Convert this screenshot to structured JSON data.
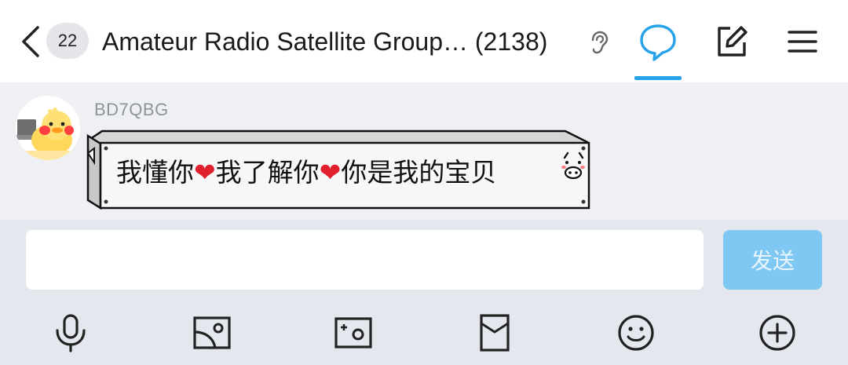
{
  "header": {
    "back_icon": "chevron-left-icon",
    "unread_count": "22",
    "title": "Amateur Radio Satellite Group… (2138)",
    "ear_icon": "ear-icon",
    "tabs": [
      {
        "name": "chat",
        "icon": "chat-bubble-icon",
        "active": true
      },
      {
        "name": "edit",
        "icon": "edit-icon"
      },
      {
        "name": "menu",
        "icon": "hamburger-menu-icon"
      }
    ],
    "accent_color": "#26a3e8"
  },
  "messages": [
    {
      "sender": "BD7QBG",
      "avatar": "duck-avatar",
      "text_parts": [
        "我懂你",
        "❤",
        "我了解你",
        "❤",
        "你是我的宝贝"
      ],
      "sticker_icon": "pig-face-icon"
    }
  ],
  "composer": {
    "input_value": "",
    "input_placeholder": "",
    "send_label": "发送",
    "send_color": "#7fc8f3"
  },
  "toolbar": [
    {
      "name": "voice",
      "icon": "microphone-icon"
    },
    {
      "name": "image",
      "icon": "image-icon"
    },
    {
      "name": "camera",
      "icon": "camera-icon"
    },
    {
      "name": "red-packet",
      "icon": "red-envelope-icon"
    },
    {
      "name": "emoji",
      "icon": "smiley-icon"
    },
    {
      "name": "more",
      "icon": "plus-circle-icon"
    }
  ]
}
